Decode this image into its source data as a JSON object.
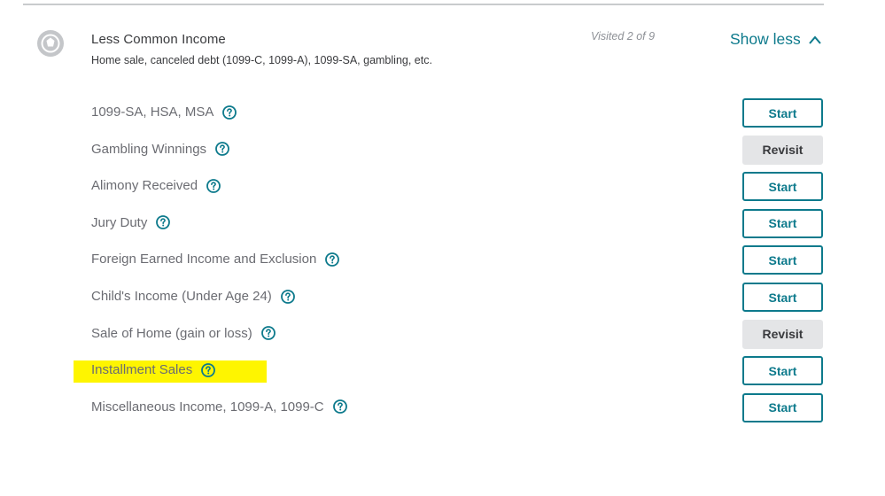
{
  "section": {
    "title": "Less Common Income",
    "subtitle": "Home sale, canceled debt (1099-C, 1099-A), 1099-SA, gambling, etc.",
    "visited": "Visited 2 of 9",
    "toggle_label": "Show less",
    "icon": "settings-circle-icon"
  },
  "colors": {
    "accent": "#0d7a8c",
    "highlight": "#fef500",
    "revisit_bg": "#e4e5e7"
  },
  "items": [
    {
      "label": "1099-SA, HSA, MSA",
      "button": "Start",
      "highlighted": false
    },
    {
      "label": "Gambling Winnings",
      "button": "Revisit",
      "highlighted": false
    },
    {
      "label": "Alimony Received",
      "button": "Start",
      "highlighted": false
    },
    {
      "label": "Jury Duty",
      "button": "Start",
      "highlighted": false
    },
    {
      "label": "Foreign Earned Income and Exclusion",
      "button": "Start",
      "highlighted": false
    },
    {
      "label": "Child's Income (Under Age 24)",
      "button": "Start",
      "highlighted": false
    },
    {
      "label": "Sale of Home (gain or loss)",
      "button": "Revisit",
      "highlighted": false
    },
    {
      "label": "Installment Sales",
      "button": "Start",
      "highlighted": true
    },
    {
      "label": "Miscellaneous Income, 1099-A, 1099-C",
      "button": "Start",
      "highlighted": false
    }
  ]
}
